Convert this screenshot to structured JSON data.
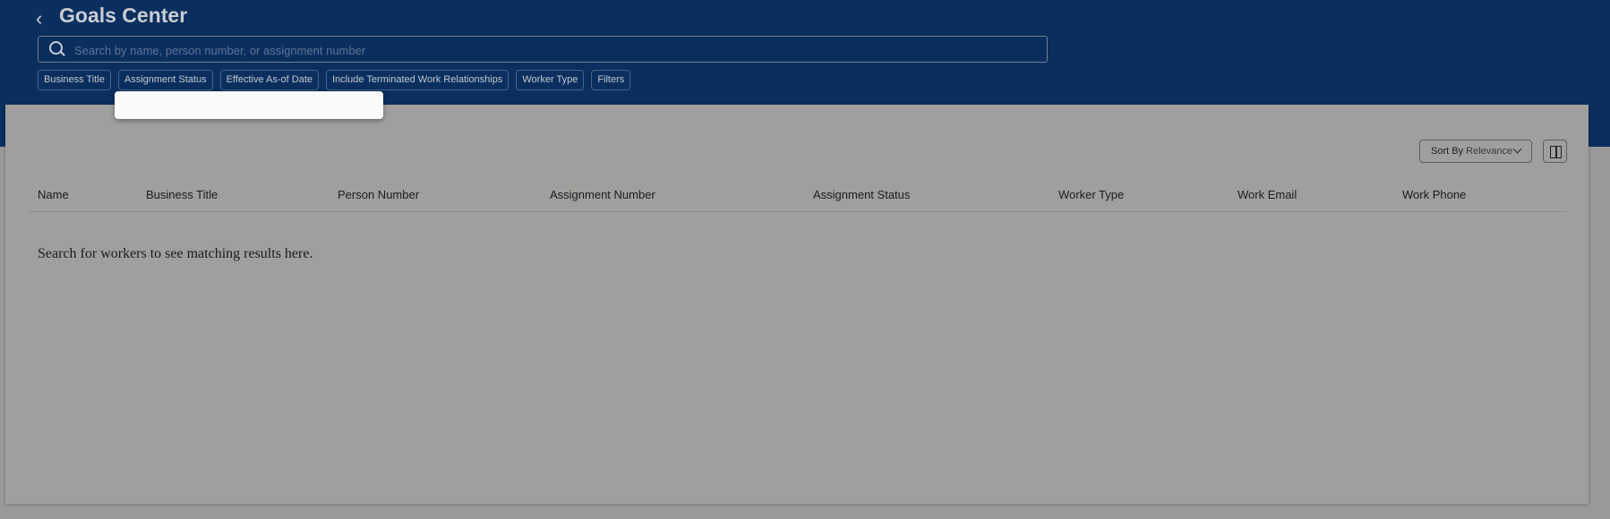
{
  "header": {
    "title": "Goals Center",
    "back_label": "‹"
  },
  "search": {
    "placeholder": "Search by name, person number, or assignment number",
    "value": ""
  },
  "filters": [
    {
      "label": "Business Title"
    },
    {
      "label": "Assignment Status"
    },
    {
      "label": "Effective As-of Date"
    },
    {
      "label": "Include Terminated Work Relationships"
    },
    {
      "label": "Worker Type"
    },
    {
      "label": "Filters"
    }
  ],
  "toolbar": {
    "sort_prefix": "Sort By",
    "sort_value": "Relevance"
  },
  "table": {
    "columns": [
      "Name",
      "Business Title",
      "Person Number",
      "Assignment Number",
      "Assignment Status",
      "Worker Type",
      "Work Email",
      "Work Phone"
    ],
    "empty_message": "Search for workers to see matching results here."
  },
  "colors": {
    "header": "#0a2f5f",
    "overlay": "#a09f9d"
  }
}
